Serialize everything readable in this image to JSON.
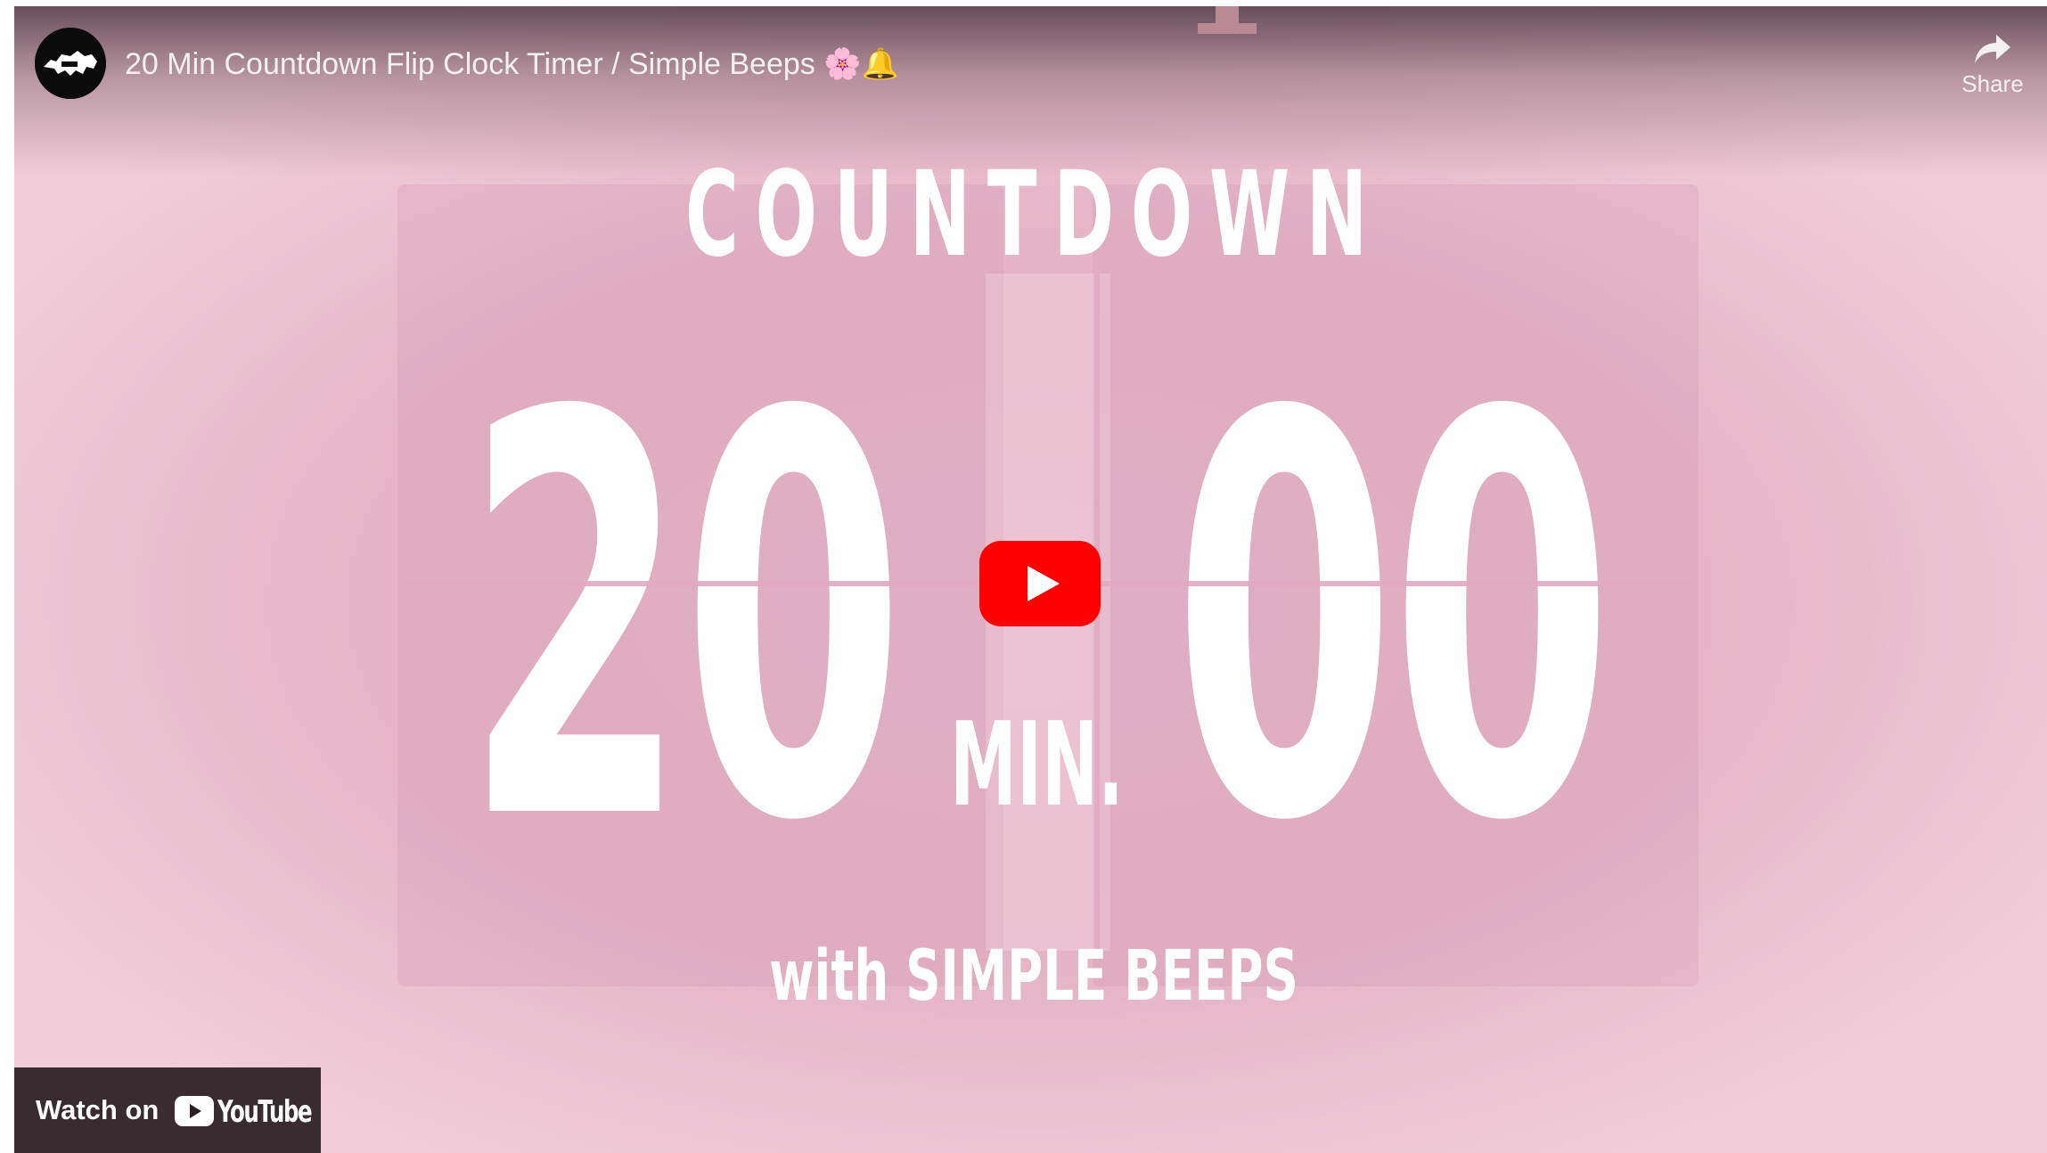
{
  "video": {
    "title": "20 Min Countdown Flip Clock Timer / Simple Beeps 🌸🔔",
    "share_label": "Share"
  },
  "thumbnail": {
    "heading": "COUNTDOWN",
    "minutes": "20",
    "min_label": "MIN.",
    "seconds": "00",
    "subtitle": "with SIMPLE BEEPS"
  },
  "footer": {
    "watch_on_label": "Watch on",
    "platform_name": "YouTube"
  },
  "icons": {
    "channel": "channel-avatar-icon",
    "share": "share-arrow-icon",
    "play": "play-icon",
    "youtube": "youtube-logo-icon"
  },
  "colors": {
    "background_pink": "#e7b9ca",
    "play_red": "#ff0000",
    "text_white": "#ffffff"
  }
}
